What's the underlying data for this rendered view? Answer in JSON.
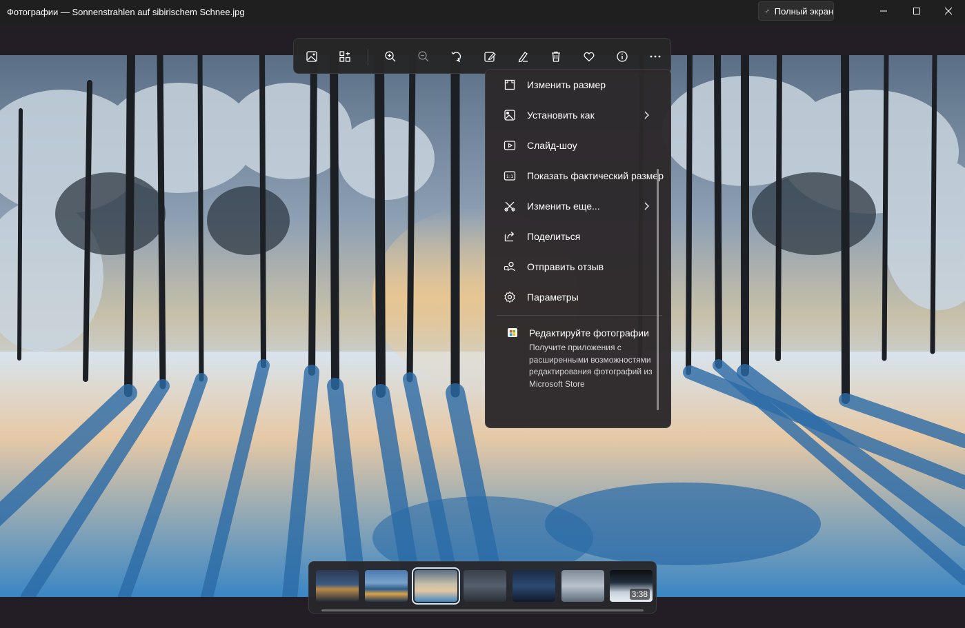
{
  "window": {
    "title": "Фотографии — Sonnenstrahlen auf sibirischem Schnee.jpg",
    "fullscreen_label": "Полный экран"
  },
  "toolbar": {
    "buttons": [
      {
        "name": "view-image-icon"
      },
      {
        "name": "add-to-collection-icon"
      },
      {
        "name": "zoom-in-icon"
      },
      {
        "name": "zoom-out-icon"
      },
      {
        "name": "rotate-icon"
      },
      {
        "name": "edit-image-icon"
      },
      {
        "name": "draw-icon"
      },
      {
        "name": "delete-icon"
      },
      {
        "name": "favorite-icon"
      },
      {
        "name": "info-icon"
      },
      {
        "name": "more-options-icon"
      }
    ]
  },
  "menu": {
    "items": [
      {
        "label": "Изменить размер",
        "icon": "resize-icon",
        "submenu": false
      },
      {
        "label": "Установить как",
        "icon": "set-as-icon",
        "submenu": true
      },
      {
        "label": "Слайд-шоу",
        "icon": "slideshow-icon",
        "submenu": false
      },
      {
        "label": "Показать фактический размер",
        "icon": "actual-size-icon",
        "submenu": false
      },
      {
        "label": "Изменить еще...",
        "icon": "edit-more-icon",
        "submenu": true
      },
      {
        "label": "Поделиться",
        "icon": "share-icon",
        "submenu": false
      },
      {
        "label": "Отправить отзыв",
        "icon": "feedback-icon",
        "submenu": false
      },
      {
        "label": "Параметры",
        "icon": "settings-icon",
        "submenu": false
      }
    ],
    "promo": {
      "title": "Редактируйте фотографии",
      "description": "Получите приложения с расширенными возможностями редактирования фотографий из Microsoft Store"
    }
  },
  "filmstrip": {
    "thumbnails": [
      {
        "name": "thumb-1",
        "selected": false
      },
      {
        "name": "thumb-2",
        "selected": false
      },
      {
        "name": "thumb-3",
        "selected": true
      },
      {
        "name": "thumb-4",
        "selected": false
      },
      {
        "name": "thumb-5",
        "selected": false
      },
      {
        "name": "thumb-6",
        "selected": false
      },
      {
        "name": "thumb-7",
        "selected": false,
        "duration": "3:38"
      }
    ]
  }
}
